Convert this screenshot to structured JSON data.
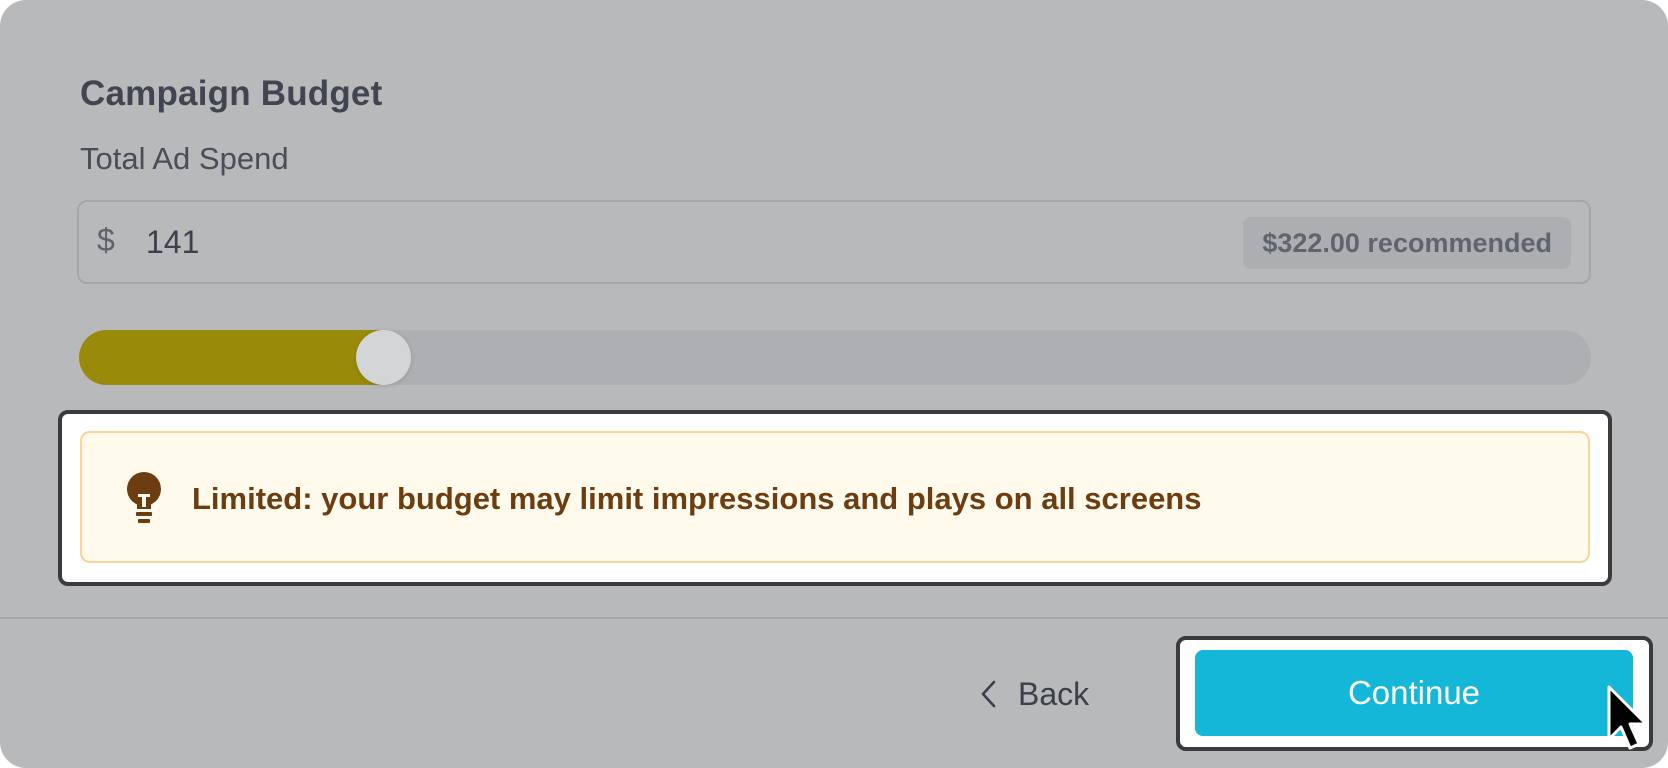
{
  "budget": {
    "title": "Campaign Budget",
    "field_label": "Total Ad Spend",
    "currency_symbol": "$",
    "amount": "141",
    "recommended": "$322.00 recommended",
    "slider_fraction": 0.2,
    "accent_color": "#9a8a0a"
  },
  "callout": {
    "icon": "lightbulb-icon",
    "text": "Limited: your budget may limit impressions and plays on all screens"
  },
  "footer": {
    "back_label": "Back",
    "continue_label": "Continue",
    "continue_color": "#15b7d8"
  }
}
